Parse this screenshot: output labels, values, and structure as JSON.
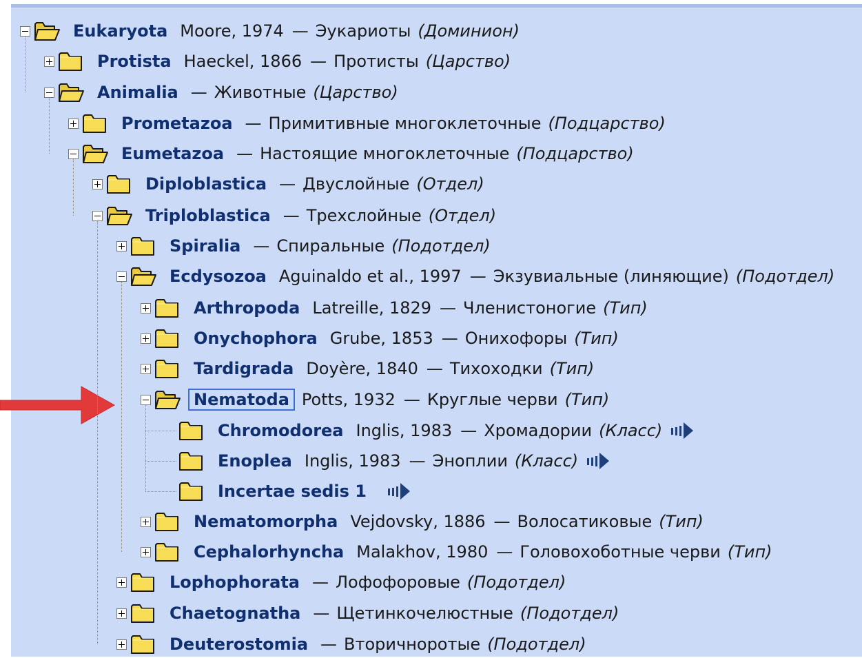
{
  "colors": {
    "panel_bg": "#cbdaf7",
    "name_text": "#0f2f6e",
    "folder": "#f6dd55",
    "arrow": "#e23a3a",
    "selected_border": "#3b6fd6"
  },
  "tree": {
    "nodes": [
      {
        "id": "eukaryota",
        "name": "Eukaryota",
        "author": "Moore, 1974",
        "ru": "Эукариоты",
        "rank": "(Доминион)",
        "state": "open",
        "folder_icon": "folder-open-icon"
      },
      {
        "id": "protista",
        "name": "Protista",
        "author": "Haeckel, 1866",
        "ru": "Протисты",
        "rank": "(Царство)",
        "state": "closed",
        "folder_icon": "folder-icon"
      },
      {
        "id": "animalia",
        "name": "Animalia",
        "author": "",
        "ru": "Животные",
        "rank": "(Царство)",
        "state": "open",
        "folder_icon": "folder-open-icon"
      },
      {
        "id": "prometazoa",
        "name": "Prometazoa",
        "author": "",
        "ru": "Примитивные многоклеточные",
        "rank": "(Подцарство)",
        "state": "closed",
        "folder_icon": "folder-icon"
      },
      {
        "id": "eumetazoa",
        "name": "Eumetazoa",
        "author": "",
        "ru": "Настоящие многоклеточные",
        "rank": "(Подцарство)",
        "state": "open",
        "folder_icon": "folder-open-icon"
      },
      {
        "id": "diploblastica",
        "name": "Diploblastica",
        "author": "",
        "ru": "Двуслойные",
        "rank": "(Отдел)",
        "state": "closed",
        "folder_icon": "folder-icon"
      },
      {
        "id": "triploblastica",
        "name": "Triploblastica",
        "author": "",
        "ru": "Трехслойные",
        "rank": "(Отдел)",
        "state": "open",
        "folder_icon": "folder-open-icon"
      },
      {
        "id": "spiralia",
        "name": "Spiralia",
        "author": "",
        "ru": "Спиральные",
        "rank": "(Подотдел)",
        "state": "closed",
        "folder_icon": "folder-icon"
      },
      {
        "id": "ecdysozoa",
        "name": "Ecdysozoa",
        "author": "Aguinaldo et al., 1997",
        "ru": "Экзувиальные (линяющие)",
        "rank": "(Подотдел)",
        "state": "open",
        "folder_icon": "folder-open-icon"
      },
      {
        "id": "arthropoda",
        "name": "Arthropoda",
        "author": "Latreille, 1829",
        "ru": "Членистоногие",
        "rank": "(Тип)",
        "state": "closed",
        "folder_icon": "folder-icon"
      },
      {
        "id": "onychophora",
        "name": "Onychophora",
        "author": "Grube, 1853",
        "ru": "Онихофоры",
        "rank": "(Тип)",
        "state": "closed",
        "folder_icon": "folder-icon"
      },
      {
        "id": "tardigrada",
        "name": "Tardigrada",
        "author": "Doyère, 1840",
        "ru": "Тихоходки",
        "rank": "(Тип)",
        "state": "closed",
        "folder_icon": "folder-icon"
      },
      {
        "id": "nematoda",
        "name": "Nematoda",
        "author": "Potts, 1932",
        "ru": "Круглые черви",
        "rank": "(Тип)",
        "state": "open",
        "selected": true,
        "folder_icon": "folder-open-icon"
      },
      {
        "id": "chromodorea",
        "name": "Chromodorea",
        "author": "Inglis, 1983",
        "ru": "Хромадории",
        "rank": "(Класс)",
        "state": "leaf",
        "more_icon": "more-arrow-icon",
        "folder_icon": "folder-icon"
      },
      {
        "id": "enoplea",
        "name": "Enoplea",
        "author": "Inglis, 1983",
        "ru": "Эноплии",
        "rank": "(Класс)",
        "state": "leaf",
        "more_icon": "more-arrow-icon",
        "folder_icon": "folder-icon"
      },
      {
        "id": "incertae",
        "name": "Incertae sedis 1",
        "author": "",
        "ru": "",
        "rank": "",
        "state": "leaf",
        "more_icon": "more-arrow-icon",
        "folder_icon": "folder-icon"
      },
      {
        "id": "nematomorpha",
        "name": "Nematomorpha",
        "author": "Vejdovsky, 1886",
        "ru": "Волосатиковые",
        "rank": "(Тип)",
        "state": "closed",
        "folder_icon": "folder-icon"
      },
      {
        "id": "cephalorhyncha",
        "name": "Cephalorhyncha",
        "author": "Malakhov, 1980",
        "ru": "Головохоботные черви",
        "rank": "(Тип)",
        "state": "closed",
        "folder_icon": "folder-icon"
      },
      {
        "id": "lophophorata",
        "name": "Lophophorata",
        "author": "",
        "ru": "Лофофоровые",
        "rank": "(Подотдел)",
        "state": "closed",
        "folder_icon": "folder-icon"
      },
      {
        "id": "chaetognatha",
        "name": "Chaetognatha",
        "author": "",
        "ru": "Щетинкочелюстные",
        "rank": "(Подотдел)",
        "state": "closed",
        "folder_icon": "folder-icon"
      },
      {
        "id": "deuterostomia",
        "name": "Deuterostomia",
        "author": "",
        "ru": "Вторичноротые",
        "rank": "(Подотдел)",
        "state": "closed",
        "folder_icon": "folder-icon"
      }
    ]
  }
}
